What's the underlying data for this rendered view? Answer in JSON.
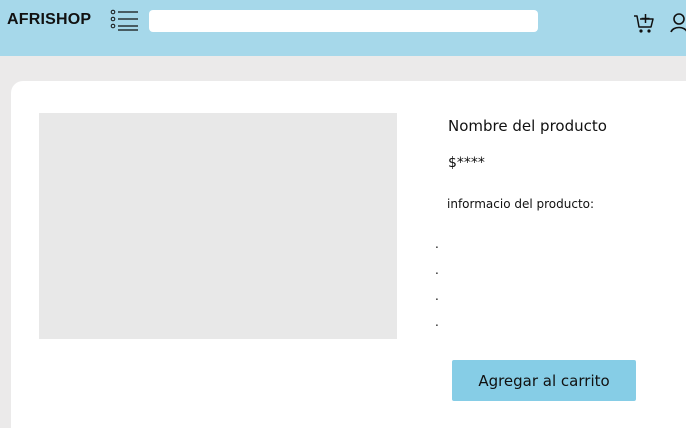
{
  "header": {
    "logo": "AFRISHOP",
    "search_placeholder": "",
    "menu_icon": "list-menu-icon",
    "cart_icon": "shopping-cart-add-icon",
    "user_icon": "user-icon",
    "background": "#a6d8ea"
  },
  "product": {
    "name": "Nombre del producto",
    "price": "$****",
    "info_label": "informacio del producto:",
    "info_items": [
      ".",
      ".",
      ".",
      "."
    ],
    "add_to_cart_label": "Agregar al carrito",
    "button_color": "#86cde6",
    "image_placeholder_color": "#e8e8e8"
  }
}
